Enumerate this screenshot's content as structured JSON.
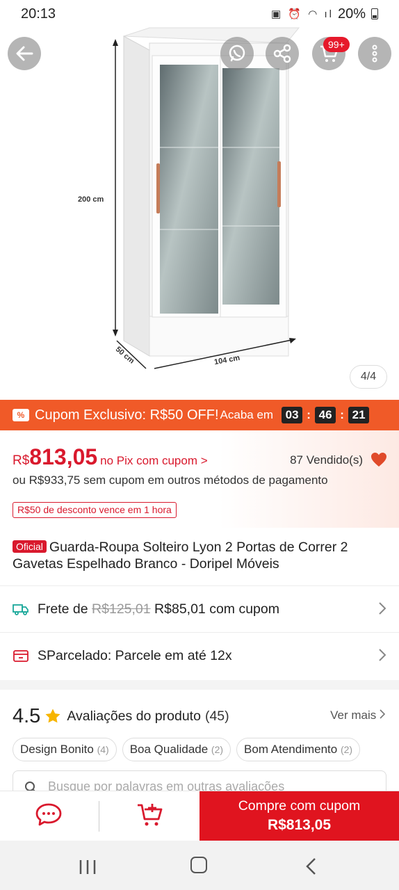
{
  "status_bar": {
    "time": "20:13",
    "battery": "20%"
  },
  "hero": {
    "dimension_height": "200 cm",
    "dimension_width": "104 cm",
    "dimension_depth": "50 cm",
    "cart_badge": "99+",
    "page_indicator": "4/4"
  },
  "coupon": {
    "title": "Cupom Exclusivo: R$50 OFF!",
    "ends_label": "Acaba em",
    "hours": "03",
    "minutes": "46",
    "seconds": "21",
    "accent": "#f05a28"
  },
  "price": {
    "currency": "R$",
    "amount": "813,05",
    "pix_label": "no Pix com cupom >",
    "sold": "87 Vendido(s)",
    "alt_price": "ou R$933,75 sem cupom em outros métodos de pagamento",
    "discount_tag": "R$50 de desconto vence em 1 hora",
    "color": "#d9192d"
  },
  "product": {
    "official_tag": "Oficial",
    "title": "Guarda-Roupa Solteiro Lyon 2 Portas de Correr 2 Gavetas Espelhado Branco - Doripel Móveis"
  },
  "shipping": {
    "label": "Frete de",
    "old_price": "R$125,01",
    "new_price": "R$85,01 com cupom"
  },
  "installments": {
    "label": "SParcelado: Parcele em até 12x"
  },
  "reviews": {
    "rating": "4.5",
    "title": "Avaliações do produto",
    "count": "(45)",
    "see_more": "Ver mais",
    "chips": [
      {
        "label": "Design Bonito",
        "count": "(4)"
      },
      {
        "label": "Boa Qualidade",
        "count": "(2)"
      },
      {
        "label": "Bom Atendimento",
        "count": "(2)"
      }
    ],
    "search_placeholder": "Busque por palavras em outras avaliações"
  },
  "action_bar": {
    "buy_label": "Compre com cupom",
    "buy_price": "R$813,05",
    "buy_color": "#e0141f"
  },
  "icons": [
    "back-arrow-icon",
    "whatsapp-icon",
    "share-icon",
    "cart-icon",
    "more-icon",
    "coupon-icon",
    "heart-icon",
    "truck-icon",
    "card-icon",
    "chevron-right-icon",
    "star-icon",
    "search-icon",
    "chat-icon",
    "add-to-cart-icon"
  ]
}
